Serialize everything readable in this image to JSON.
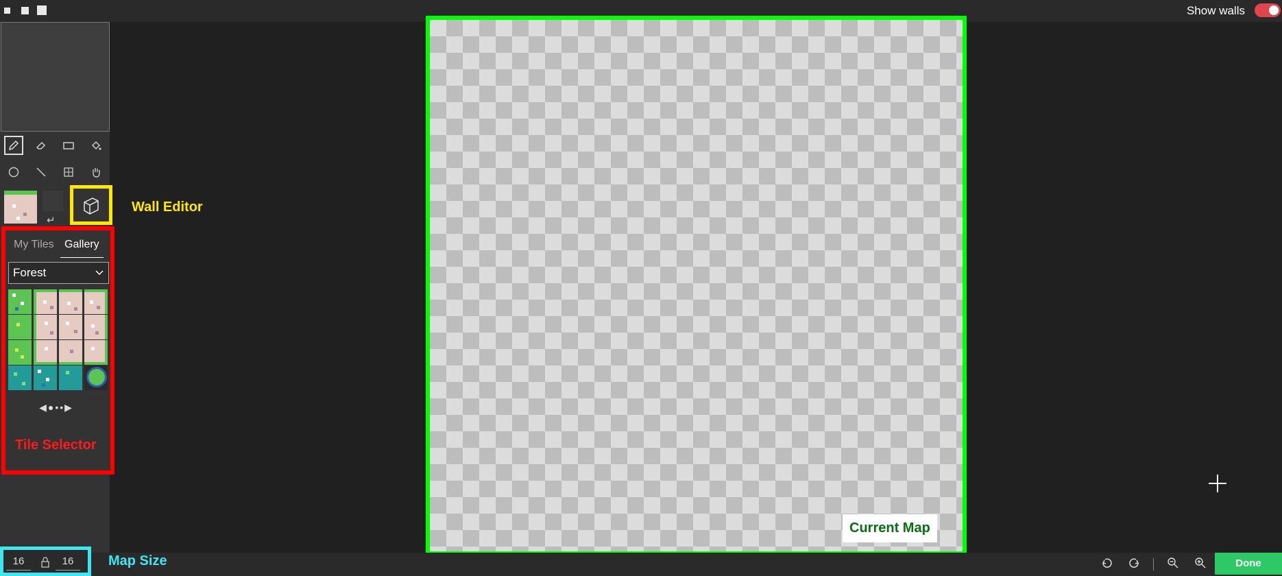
{
  "window": {
    "controls": [
      "small",
      "medium",
      "large"
    ]
  },
  "header": {
    "show_walls_label": "Show walls",
    "show_walls_on": true
  },
  "tools": {
    "row1": [
      "pencil-icon",
      "eraser-icon",
      "rectangle-icon",
      "fill-bucket-icon"
    ],
    "row2": [
      "circle-icon",
      "line-icon",
      "grid-icon",
      "hand-icon"
    ],
    "active": "pencil-icon"
  },
  "wall_editor": {
    "label": "Wall Editor",
    "return_glyph": "↵"
  },
  "tile_selector": {
    "tabs": [
      {
        "label": "My Tiles"
      },
      {
        "label": "Gallery"
      }
    ],
    "active_tab": "Gallery",
    "set": "Forest",
    "label": "Tile Selector",
    "pager": "◀●••▶"
  },
  "map": {
    "label": "Current Map",
    "width": "16",
    "height": "16",
    "size_label": "Map Size"
  },
  "bottom": {
    "done_label": "Done"
  },
  "colors": {
    "accent_walls": "#ffe800",
    "tile_panel": "#ff0000",
    "map_border": "#00ff00",
    "map_size": "#3ee6f0",
    "done": "#2ec866"
  }
}
